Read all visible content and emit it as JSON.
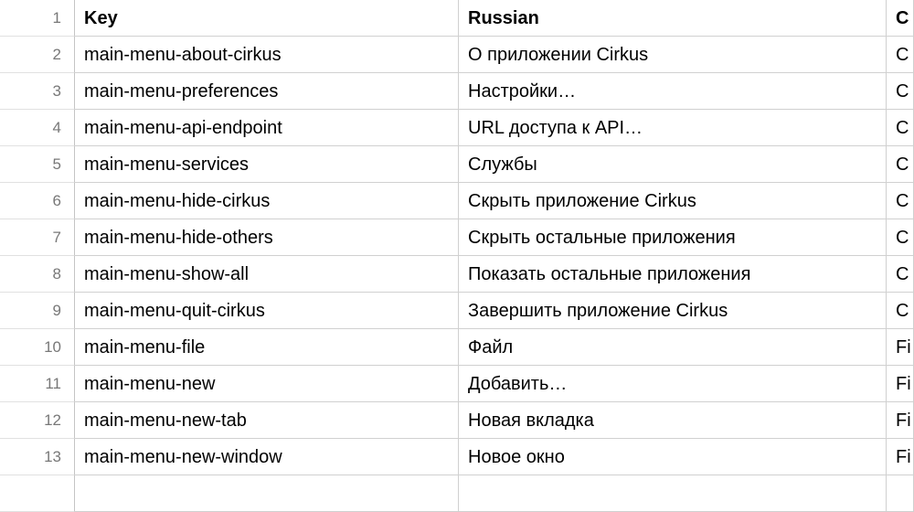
{
  "columns": {
    "key": "Key",
    "russian": "Russian",
    "third_partial": "C"
  },
  "rows": [
    {
      "num": "1"
    },
    {
      "num": "2",
      "key": "main-menu-about-cirkus",
      "russian": "О приложении Cirkus",
      "third": "C"
    },
    {
      "num": "3",
      "key": "main-menu-preferences",
      "russian": "Настройки…",
      "third": "C"
    },
    {
      "num": "4",
      "key": "main-menu-api-endpoint",
      "russian": "URL доступа к API…",
      "third": "C"
    },
    {
      "num": "5",
      "key": "main-menu-services",
      "russian": "Службы",
      "third": "C"
    },
    {
      "num": "6",
      "key": "main-menu-hide-cirkus",
      "russian": "Скрыть приложение Cirkus",
      "third": "C"
    },
    {
      "num": "7",
      "key": "main-menu-hide-others",
      "russian": "Скрыть остальные приложения",
      "third": "C"
    },
    {
      "num": "8",
      "key": "main-menu-show-all",
      "russian": "Показать остальные приложения",
      "third": "C"
    },
    {
      "num": "9",
      "key": "main-menu-quit-cirkus",
      "russian": "Завершить приложение Cirkus",
      "third": "C"
    },
    {
      "num": "10",
      "key": "main-menu-file",
      "russian": "Файл",
      "third": "Fi"
    },
    {
      "num": "11",
      "key": "main-menu-new",
      "russian": "Добавить…",
      "third": "Fi"
    },
    {
      "num": "12",
      "key": "main-menu-new-tab",
      "russian": "Новая вкладка",
      "third": "Fi"
    },
    {
      "num": "13",
      "key": "main-menu-new-window",
      "russian": "Новое окно",
      "third": "Fi"
    }
  ]
}
